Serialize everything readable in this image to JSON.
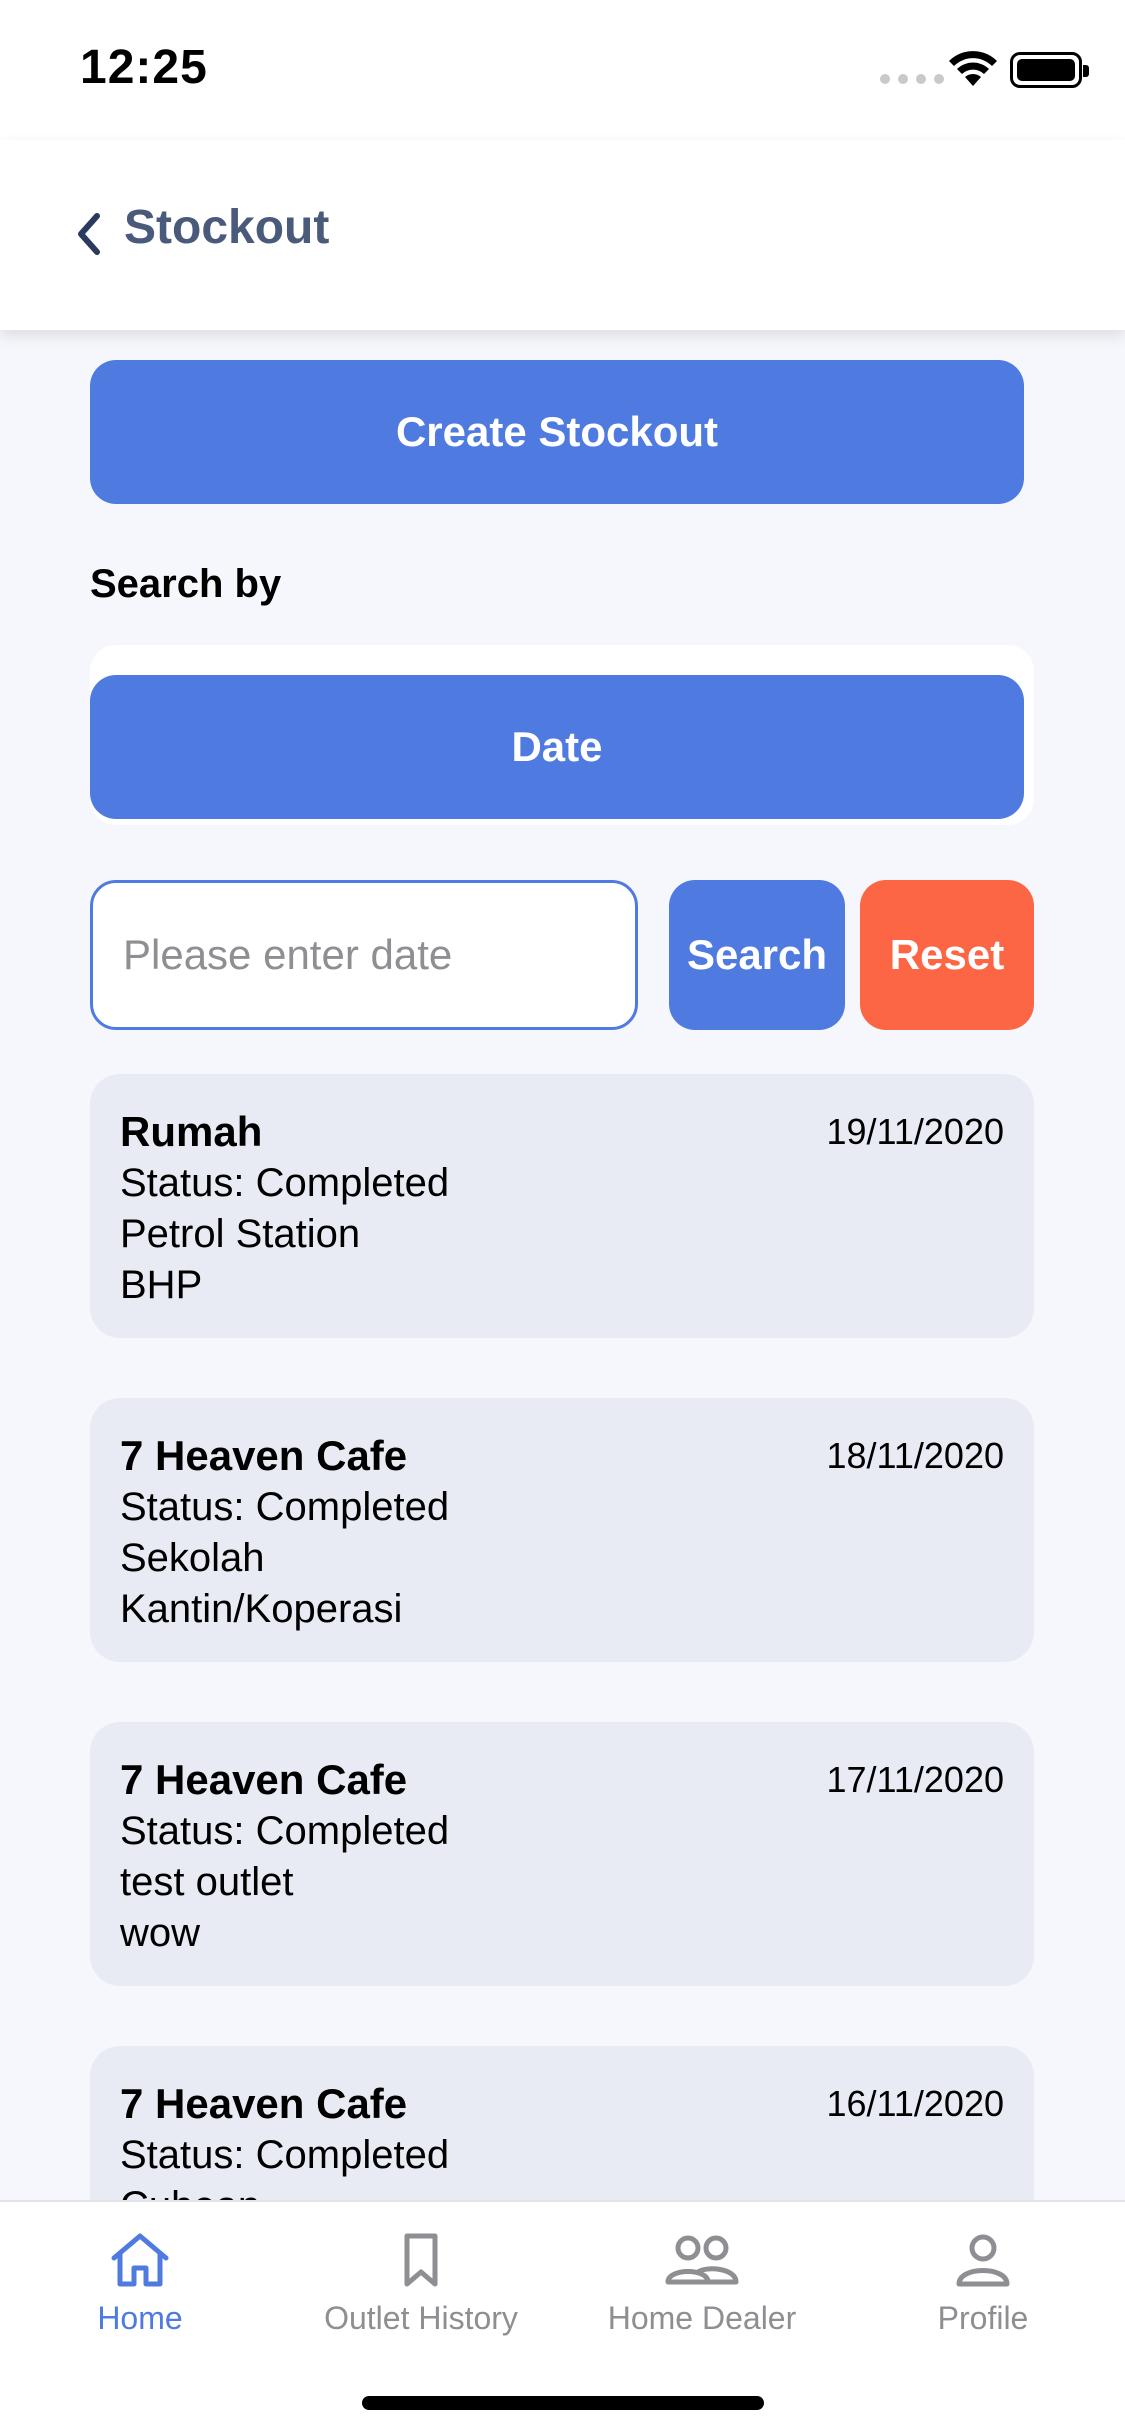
{
  "status_bar": {
    "time": "12:25"
  },
  "header": {
    "title": "Stockout"
  },
  "actions": {
    "create_label": "Create Stockout"
  },
  "search": {
    "label": "Search by",
    "filter_option": "Date",
    "placeholder": "Please enter date",
    "value": "",
    "search_label": "Search",
    "reset_label": "Reset"
  },
  "stockouts": [
    {
      "name": "Rumah",
      "status": "Status: Completed",
      "line1": "Petrol Station",
      "line2": "BHP",
      "date": "19/11/2020"
    },
    {
      "name": "7 Heaven Cafe",
      "status": "Status: Completed",
      "line1": "Sekolah",
      "line2": "Kantin/Koperasi",
      "date": "18/11/2020"
    },
    {
      "name": "7 Heaven Cafe",
      "status": "Status: Completed",
      "line1": "test outlet",
      "line2": "wow",
      "date": "17/11/2020"
    },
    {
      "name": "7 Heaven Cafe",
      "status": "Status: Completed",
      "line1": "Cubean",
      "line2": "",
      "date": "16/11/2020"
    }
  ],
  "tabs": [
    {
      "label": "Home",
      "icon": "home-icon",
      "active": true
    },
    {
      "label": "Outlet History",
      "icon": "bookmark-icon",
      "active": false
    },
    {
      "label": "Home Dealer",
      "icon": "people-icon",
      "active": false
    },
    {
      "label": "Profile",
      "icon": "person-icon",
      "active": false
    }
  ],
  "colors": {
    "primary": "#4f7be0",
    "reset": "#fd6644",
    "card": "#e8ebf3",
    "background": "#f5f7fc"
  }
}
